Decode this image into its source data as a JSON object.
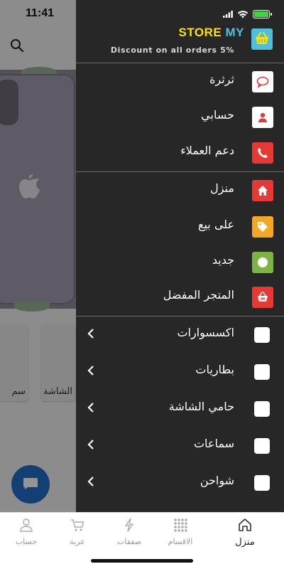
{
  "status": {
    "time": "11:41"
  },
  "store": {
    "name_part1": "STORE",
    "name_part2": "MY",
    "subtitle": "Discount on all orders 5%"
  },
  "menu_top": [
    {
      "label": "ثرثرة",
      "icon": "chat-icon",
      "color": "#ffffff"
    },
    {
      "label": "حسابي",
      "icon": "person-icon",
      "color": "#ffffff"
    },
    {
      "label": "دعم العملاء",
      "icon": "phone-icon",
      "color": "#e53935"
    }
  ],
  "menu_mid": [
    {
      "label": "منزل",
      "icon": "home-icon",
      "color": "#e53935"
    },
    {
      "label": "على بيع",
      "icon": "tag-icon",
      "color": "#f5a623"
    },
    {
      "label": "جديد",
      "icon": "circle-icon",
      "color": "#7cb342"
    },
    {
      "label": "المتجر المفضل",
      "icon": "basket-icon",
      "color": "#e53935"
    }
  ],
  "categories": [
    {
      "label": "اكسسوارات"
    },
    {
      "label": "بطاريات"
    },
    {
      "label": "حامي الشاشة"
    },
    {
      "label": "سماعات"
    },
    {
      "label": "شواحن"
    }
  ],
  "background": {
    "card_label_1": "الشاشة",
    "card_label_2": "سم"
  },
  "tabs": [
    {
      "label": "منزل",
      "icon": "home-icon",
      "active": true
    },
    {
      "label": "الاقسام",
      "icon": "grid-icon",
      "active": false
    },
    {
      "label": "صفقات",
      "icon": "bolt-icon",
      "active": false
    },
    {
      "label": "عربة",
      "icon": "cart-icon",
      "active": false
    },
    {
      "label": "حساب",
      "icon": "user-icon",
      "active": false
    }
  ],
  "colors": {
    "drawer_bg": "#272727",
    "accent_yellow": "#ffe000",
    "accent_cyan": "#4fc0dc"
  }
}
